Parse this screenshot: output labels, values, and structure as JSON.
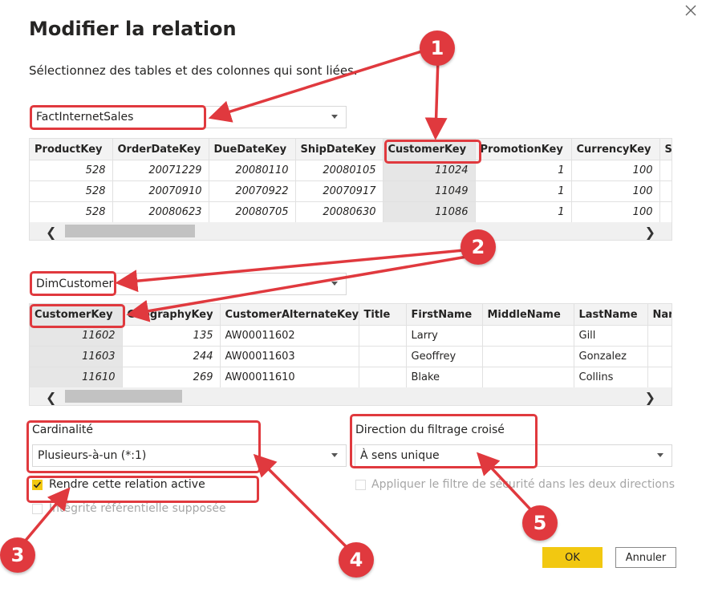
{
  "dialog": {
    "title": "Modifier la relation",
    "subtitle": "Sélectionnez des tables et des colonnes qui sont liées."
  },
  "table1": {
    "selected": "FactInternetSales",
    "columns": [
      "ProductKey",
      "OrderDateKey",
      "DueDateKey",
      "ShipDateKey",
      "CustomerKey",
      "PromotionKey",
      "CurrencyKey",
      "S"
    ],
    "rows": [
      [
        "528",
        "20071229",
        "20080110",
        "20080105",
        "11024",
        "1",
        "100",
        ""
      ],
      [
        "528",
        "20070910",
        "20070922",
        "20070917",
        "11049",
        "1",
        "100",
        ""
      ],
      [
        "528",
        "20080623",
        "20080705",
        "20080630",
        "11086",
        "1",
        "100",
        ""
      ]
    ],
    "selected_column": "CustomerKey"
  },
  "table2": {
    "selected": "DimCustomer",
    "columns": [
      "CustomerKey",
      "GeographyKey",
      "CustomerAlternateKey",
      "Title",
      "FirstName",
      "MiddleName",
      "LastName",
      "Nan"
    ],
    "rows": [
      [
        "11602",
        "135",
        "AW00011602",
        "",
        "Larry",
        "",
        "Gill",
        ""
      ],
      [
        "11603",
        "244",
        "AW00011603",
        "",
        "Geoffrey",
        "",
        "Gonzalez",
        ""
      ],
      [
        "11610",
        "269",
        "AW00011610",
        "",
        "Blake",
        "",
        "Collins",
        ""
      ]
    ],
    "selected_column": "CustomerKey"
  },
  "cardinality": {
    "label": "Cardinalité",
    "value": "Plusieurs-à-un (*:1)"
  },
  "cross_filter": {
    "label": "Direction du filtrage croisé",
    "value": "À sens unique"
  },
  "options": {
    "active": {
      "label": "Rendre cette relation active",
      "checked": true
    },
    "integrity": {
      "label": "Intégrité référentielle supposée",
      "checked": false
    },
    "security": {
      "label": "Appliquer le filtre de sécurité dans les deux directions",
      "checked": false
    }
  },
  "buttons": {
    "ok": "OK",
    "cancel": "Annuler"
  },
  "scroll": {
    "left": "❮",
    "right": "❯"
  },
  "close_glyph": "✕",
  "annotations": [
    "1",
    "2",
    "3",
    "4",
    "5"
  ],
  "colors": {
    "accent": "#f2c811",
    "annotation": "#e0393e"
  }
}
